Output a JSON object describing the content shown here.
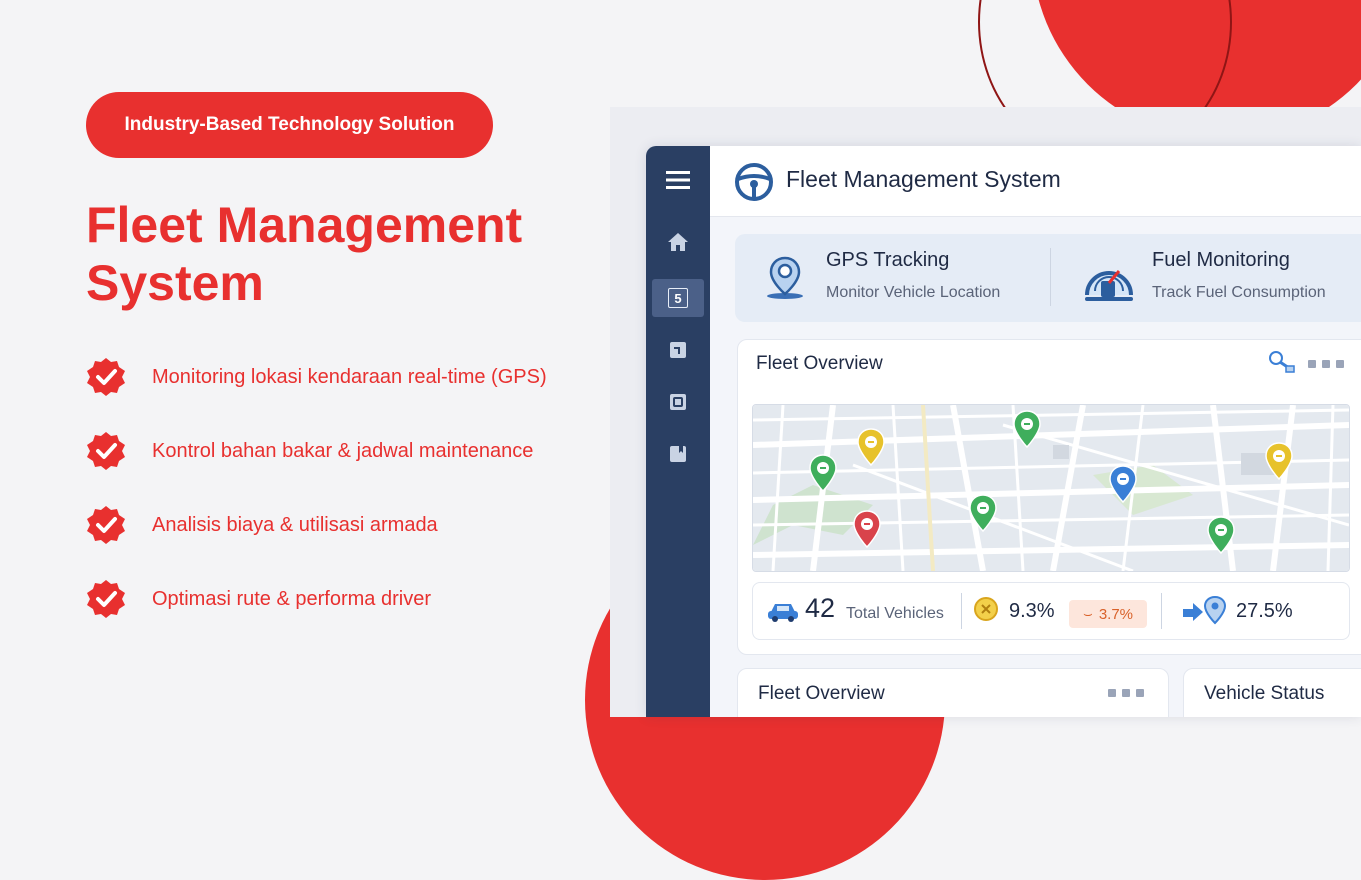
{
  "hero": {
    "badge": "Industry-Based Technology Solution",
    "headline_line1": "Fleet Management",
    "headline_line2": "System",
    "features": [
      {
        "label": "Monitoring lokasi kendaraan real-time (GPS)"
      },
      {
        "label": "Kontrol bahan bakar & jadwal maintenance"
      },
      {
        "label": "Analisis biaya & utilisasi armada"
      },
      {
        "label": "Optimasi rute & performa driver"
      }
    ]
  },
  "app": {
    "title": "Fleet Management System",
    "sidebar_badge": "5",
    "tiles": [
      {
        "title": "GPS Tracking",
        "subtitle": "Monitor Vehicle Location",
        "icon": "location-pin-icon"
      },
      {
        "title": "Fuel Monitoring",
        "subtitle": "Track Fuel Consumption",
        "icon": "fuel-gauge-icon"
      }
    ],
    "overview": {
      "title": "Fleet Overview",
      "total_vehicles_count": "42",
      "total_vehicles_label": "Total Vehicles",
      "fuel_rate": "9.3%",
      "fuel_change": "3.7%",
      "route_rate": "27.5%"
    },
    "bottom_cards": [
      {
        "title": "Fleet Overview"
      },
      {
        "title": "Vehicle Status"
      }
    ]
  },
  "colors": {
    "brand_red": "#e8302f",
    "sidebar_navy": "#2a3f63",
    "pin_green": "#3fae5c",
    "pin_yellow": "#e7c22b",
    "pin_blue": "#3a7fd6",
    "pin_red": "#d9434b"
  }
}
